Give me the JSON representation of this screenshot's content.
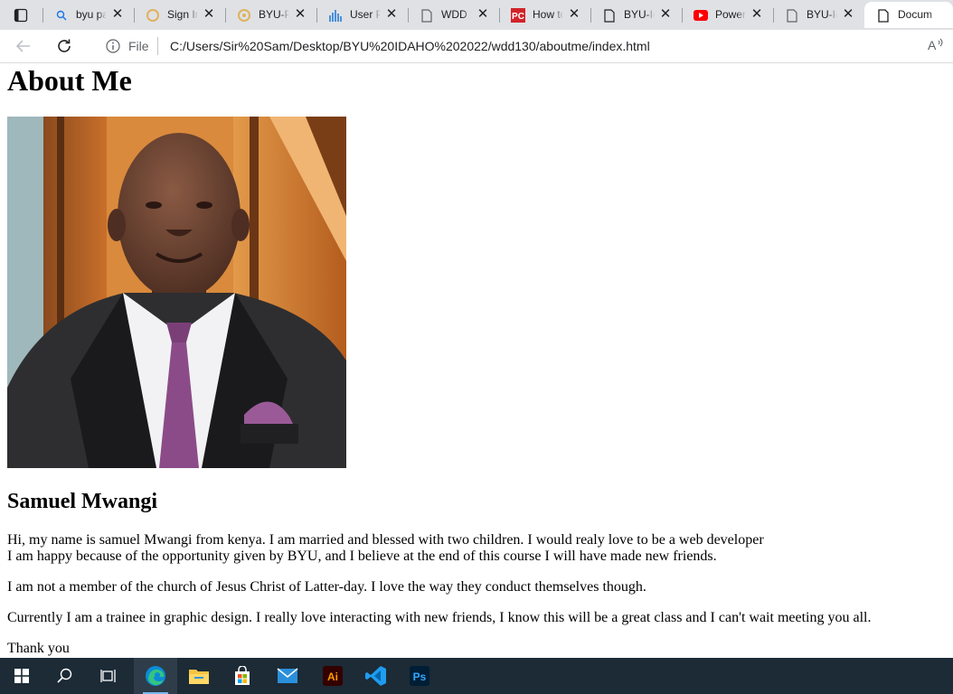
{
  "browser": {
    "tabs": [
      {
        "title": "byu pa",
        "icon": "search-icon"
      },
      {
        "title": "Sign In",
        "icon": "byu-logo-icon"
      },
      {
        "title": "BYU-Pa",
        "icon": "byu-logo-icon"
      },
      {
        "title": "User P",
        "icon": "chart-icon"
      },
      {
        "title": "WDD 1",
        "icon": "page-icon"
      },
      {
        "title": "How to",
        "icon": "pc-mag-icon"
      },
      {
        "title": "BYU-Id",
        "icon": "page-icon"
      },
      {
        "title": "Power",
        "icon": "youtube-icon"
      },
      {
        "title": "BYU-Id",
        "icon": "page-icon"
      },
      {
        "title": "Docum",
        "icon": "page-icon",
        "active": true
      }
    ],
    "address": {
      "scheme_label": "File",
      "url": "C:/Users/Sir%20Sam/Desktop/BYU%20IDAHO%202022/wdd130/aboutme/index.html"
    }
  },
  "page": {
    "heading": "About Me",
    "name": "Samuel Mwangi",
    "para1_line1": "Hi, my name is samuel Mwangi from kenya. I am married and blessed with two children. I would realy love to be a web developer",
    "para1_line2": "I am happy because of the opportunity given by BYU, and I believe at the end of this course I will have made new friends.",
    "para2": "I am not a member of the church of Jesus Christ of Latter-day. I love the way they conduct themselves though.",
    "para3": "Currently I am a trainee in graphic design. I really love interacting with new friends, I know this will be a great class and I can't wait meeting you all.",
    "para4": "Thank you"
  },
  "taskbar": {
    "items": [
      "windows-start-icon",
      "search-icon",
      "task-view-icon",
      "edge-icon",
      "file-explorer-icon",
      "store-icon",
      "mail-icon",
      "illustrator-icon",
      "vscode-icon",
      "photoshop-icon"
    ],
    "illustrator_label": "Ai",
    "photoshop_label": "Ps"
  },
  "colors": {
    "tabstrip": "#dfe1e5",
    "taskbar": "#1c2b36",
    "accent": "#76b9ed"
  }
}
